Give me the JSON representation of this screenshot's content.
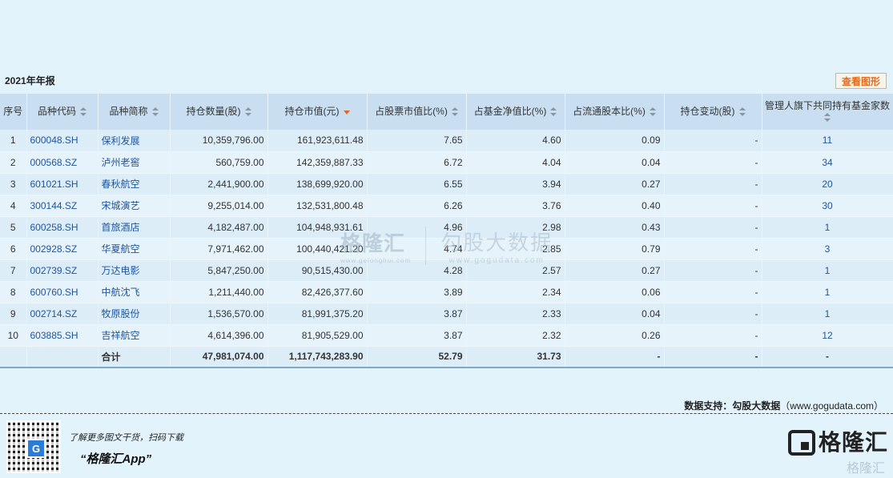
{
  "report_title": "2021年年报",
  "view_chart_label": "查看图形",
  "table": {
    "headers": [
      "序号",
      "品种代码",
      "品种简称",
      "持仓数量(股)",
      "持仓市值(元)",
      "占股票市值比(%)",
      "占基金净值比(%)",
      "占流通股本比(%)",
      "持仓变动(股)",
      "管理人旗下共同持有基金家数"
    ],
    "rows": [
      {
        "no": "1",
        "code": "600048.SH",
        "name": "保利发展",
        "qty": "10,359,796.00",
        "value": "161,923,611.48",
        "stock_pct": "7.65",
        "nav_pct": "4.60",
        "float_pct": "0.09",
        "change": "-",
        "funds": "11"
      },
      {
        "no": "2",
        "code": "000568.SZ",
        "name": "泸州老窖",
        "qty": "560,759.00",
        "value": "142,359,887.33",
        "stock_pct": "6.72",
        "nav_pct": "4.04",
        "float_pct": "0.04",
        "change": "-",
        "funds": "34"
      },
      {
        "no": "3",
        "code": "601021.SH",
        "name": "春秋航空",
        "qty": "2,441,900.00",
        "value": "138,699,920.00",
        "stock_pct": "6.55",
        "nav_pct": "3.94",
        "float_pct": "0.27",
        "change": "-",
        "funds": "20"
      },
      {
        "no": "4",
        "code": "300144.SZ",
        "name": "宋城演艺",
        "qty": "9,255,014.00",
        "value": "132,531,800.48",
        "stock_pct": "6.26",
        "nav_pct": "3.76",
        "float_pct": "0.40",
        "change": "-",
        "funds": "30"
      },
      {
        "no": "5",
        "code": "600258.SH",
        "name": "首旅酒店",
        "qty": "4,182,487.00",
        "value": "104,948,931.61",
        "stock_pct": "4.96",
        "nav_pct": "2.98",
        "float_pct": "0.43",
        "change": "-",
        "funds": "1"
      },
      {
        "no": "6",
        "code": "002928.SZ",
        "name": "华夏航空",
        "qty": "7,971,462.00",
        "value": "100,440,421.20",
        "stock_pct": "4.74",
        "nav_pct": "2.85",
        "float_pct": "0.79",
        "change": "-",
        "funds": "3"
      },
      {
        "no": "7",
        "code": "002739.SZ",
        "name": "万达电影",
        "qty": "5,847,250.00",
        "value": "90,515,430.00",
        "stock_pct": "4.28",
        "nav_pct": "2.57",
        "float_pct": "0.27",
        "change": "-",
        "funds": "1"
      },
      {
        "no": "8",
        "code": "600760.SH",
        "name": "中航沈飞",
        "qty": "1,211,440.00",
        "value": "82,426,377.60",
        "stock_pct": "3.89",
        "nav_pct": "2.34",
        "float_pct": "0.06",
        "change": "-",
        "funds": "1"
      },
      {
        "no": "9",
        "code": "002714.SZ",
        "name": "牧原股份",
        "qty": "1,536,570.00",
        "value": "81,991,375.20",
        "stock_pct": "3.87",
        "nav_pct": "2.33",
        "float_pct": "0.04",
        "change": "-",
        "funds": "1"
      },
      {
        "no": "10",
        "code": "603885.SH",
        "name": "吉祥航空",
        "qty": "4,614,396.00",
        "value": "81,905,529.00",
        "stock_pct": "3.87",
        "nav_pct": "2.32",
        "float_pct": "0.26",
        "change": "-",
        "funds": "12"
      }
    ],
    "total": {
      "label": "合计",
      "qty": "47,981,074.00",
      "value": "1,117,743,283.90",
      "stock_pct": "52.79",
      "nav_pct": "31.73",
      "float_pct": "-",
      "change": "-",
      "funds": "-"
    }
  },
  "watermark": {
    "left_logo": "格隆汇",
    "left_url": "www.gelonghui.com",
    "right_logo": "勾股大数据",
    "right_url": "www.gogudata.com"
  },
  "footer": {
    "source_label": "数据支持：勾股大数据",
    "source_domain": "（www.gogudata.com）",
    "promo_line": "了解更多图文干货，扫码下载",
    "promo_app": "“格隆汇App”",
    "brand_name": "格隆汇",
    "brand_sub": "格隆汇",
    "qr_badge": "G"
  },
  "colors": {
    "background": "#e3f3fc",
    "header_bg": "#c9dff1",
    "link": "#1f55a0",
    "active_sort": "#e2652b",
    "button_text": "#e06c1e"
  },
  "sort": {
    "active_column": "持仓市值(元)",
    "direction": "desc"
  }
}
